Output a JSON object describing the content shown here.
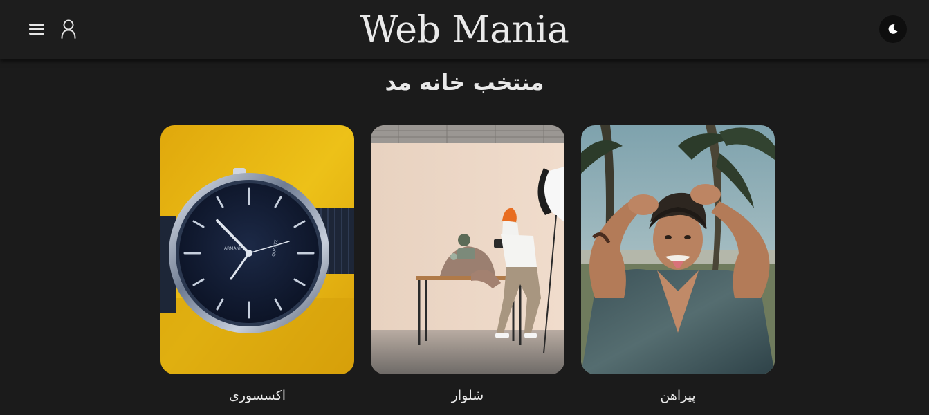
{
  "header": {
    "logo": "Web Mania",
    "menu_icon": "hamburger-menu-icon",
    "user_icon": "user-icon",
    "theme_icon": "moon-icon"
  },
  "main": {
    "section_title": "منتخب خانه مد",
    "categories": [
      {
        "label": "اکسسوری",
        "image": "watch-on-yellow-background"
      },
      {
        "label": "شلوار",
        "image": "photographer-in-studio"
      },
      {
        "label": "پیراهن",
        "image": "man-in-denim-shirt-with-palm-trees"
      }
    ]
  },
  "colors": {
    "background": "#1b1b1b",
    "header_background": "#1d1d1d",
    "text": "#e9e9e9",
    "theme_button": "#0e0e0e",
    "accent_yellow": "#e9b70f"
  }
}
